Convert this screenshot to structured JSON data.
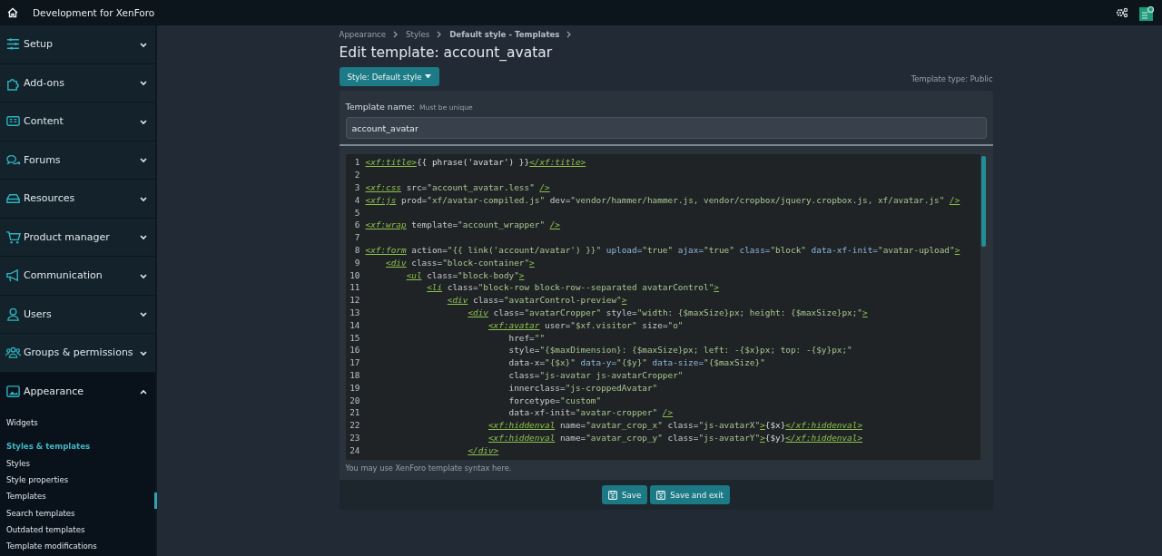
{
  "topbar": {
    "title": "Development for XenForo"
  },
  "sidebar": {
    "items": [
      {
        "label": "Setup",
        "expanded": false
      },
      {
        "label": "Add-ons",
        "expanded": false
      },
      {
        "label": "Content",
        "expanded": false
      },
      {
        "label": "Forums",
        "expanded": false
      },
      {
        "label": "Resources",
        "expanded": false
      },
      {
        "label": "Product manager",
        "expanded": false
      },
      {
        "label": "Communication",
        "expanded": false
      },
      {
        "label": "Users",
        "expanded": false
      },
      {
        "label": "Groups & permissions",
        "expanded": false
      },
      {
        "label": "Appearance",
        "expanded": true,
        "children": [
          {
            "kind": "link",
            "label": "Widgets"
          },
          {
            "kind": "header",
            "label": "Styles & templates"
          },
          {
            "kind": "link",
            "label": "Styles"
          },
          {
            "kind": "link",
            "label": "Style properties"
          },
          {
            "kind": "link",
            "label": "Templates"
          },
          {
            "kind": "link",
            "label": "Search templates"
          },
          {
            "kind": "link",
            "label": "Outdated templates"
          },
          {
            "kind": "link",
            "label": "Template modifications"
          }
        ]
      }
    ]
  },
  "breadcrumbs": [
    {
      "label": "Appearance",
      "bold": false
    },
    {
      "label": "Styles",
      "bold": false
    },
    {
      "label": "Default style - Templates",
      "bold": true
    }
  ],
  "page_title": "Edit template: account_avatar",
  "style_button": "Style: Default style",
  "template_type": "Template type: Public",
  "form": {
    "name_label": "Template name:",
    "name_hint": "Must be unique",
    "name_value": "account_avatar",
    "editor_hint": "You may use XenForo template syntax here."
  },
  "code_lines": [
    {
      "number": "1",
      "tokens": [
        {
          "kind": "tag",
          "text": "<xf:title>"
        },
        {
          "kind": "text",
          "text": "{{ phrase('avatar') }}"
        },
        {
          "kind": "tag",
          "text": "</xf:title>"
        }
      ]
    },
    {
      "number": "2"
    },
    {
      "number": "3",
      "tokens": [
        {
          "kind": "tag",
          "text": "<xf:css"
        },
        {
          "kind": "attr",
          "text": " src="
        },
        {
          "kind": "str",
          "text": "\"account_avatar.less\""
        },
        {
          "kind": "endtag",
          "text": "/>"
        }
      ]
    },
    {
      "number": "4",
      "tokens": [
        {
          "kind": "tag",
          "text": "<xf:js"
        },
        {
          "kind": "attr",
          "text": " prod="
        },
        {
          "kind": "str",
          "text": "\"xf/avatar-compiled.js\""
        },
        {
          "kind": "attr",
          "text": " dev="
        },
        {
          "kind": "str",
          "text": "\"vendor/hammer/hammer.js, vendor/cropbox/jquery.cropbox.js, xf/avatar.js\""
        },
        {
          "kind": "endtag",
          "text": "/>"
        }
      ]
    },
    {
      "number": "5"
    },
    {
      "number": "6",
      "tokens": [
        {
          "kind": "tag",
          "text": "<xf:wrap"
        },
        {
          "kind": "attr",
          "text": " template="
        },
        {
          "kind": "str",
          "text": "\"account_wrapper\""
        },
        {
          "kind": "endtag",
          "text": "/>"
        }
      ]
    },
    {
      "number": "7"
    },
    {
      "number": "8",
      "tokens": [
        {
          "kind": "tag",
          "text": "<xf:form"
        },
        {
          "kind": "attr",
          "text": " action="
        },
        {
          "kind": "str",
          "text": "\"{{ link('account/avatar') }}\""
        },
        {
          "kind": "key",
          "text": " upload="
        },
        {
          "kind": "str",
          "text": "\"true\""
        },
        {
          "kind": "key",
          "text": " ajax="
        },
        {
          "kind": "str",
          "text": "\"true\""
        },
        {
          "kind": "key",
          "text": " class="
        },
        {
          "kind": "str",
          "text": "\"block\""
        },
        {
          "kind": "key",
          "text": " data-xf-init="
        },
        {
          "kind": "str",
          "text": "\"avatar-upload\""
        },
        {
          "kind": "tag",
          "text": ">"
        }
      ],
      "children": [
        {
          "number": "9",
          "tokens": [
            {
              "kind": "tag",
              "text": "<div"
            },
            {
              "kind": "attr",
              "text": " class="
            },
            {
              "kind": "str",
              "text": "\"block-container\""
            },
            {
              "kind": "tag",
              "text": ">"
            }
          ],
          "children": [
            {
              "number": "10",
              "tokens": [
                {
                  "kind": "tag",
                  "text": "<ul"
                },
                {
                  "kind": "attr",
                  "text": " class="
                },
                {
                  "kind": "str",
                  "text": "\"block-body\""
                },
                {
                  "kind": "tag",
                  "text": ">"
                }
              ],
              "children": [
                {
                  "number": "11",
                  "tokens": [
                    {
                      "kind": "tag",
                      "text": "<li"
                    },
                    {
                      "kind": "attr",
                      "text": " class="
                    },
                    {
                      "kind": "str",
                      "text": "\"block-row block-row--separated avatarControl\""
                    },
                    {
                      "kind": "tag",
                      "text": ">"
                    }
                  ],
                  "children": [
                    {
                      "number": "12",
                      "tokens": [
                        {
                          "kind": "tag",
                          "text": "<div"
                        },
                        {
                          "kind": "attr",
                          "text": " class="
                        },
                        {
                          "kind": "str",
                          "text": "\"avatarControl-preview\""
                        },
                        {
                          "kind": "tag",
                          "text": ">"
                        }
                      ],
                      "children": [
                        {
                          "number": "13",
                          "tokens": [
                            {
                              "kind": "tag",
                              "text": "<div"
                            },
                            {
                              "kind": "attr",
                              "text": " class="
                            },
                            {
                              "kind": "str",
                              "text": "\"avatarCropper\""
                            },
                            {
                              "kind": "attr",
                              "text": " style="
                            },
                            {
                              "kind": "str",
                              "text": "\"width: {$maxSize}px; height: {$maxSize}px;\""
                            },
                            {
                              "kind": "tag",
                              "text": ">"
                            }
                          ],
                          "children": [
                            {
                              "number": "14",
                              "tokens": [
                                {
                                  "kind": "tag",
                                  "text": "<xf:avatar"
                                },
                                {
                                  "kind": "attr",
                                  "text": " user="
                                },
                                {
                                  "kind": "str",
                                  "text": "\"$xf.visitor\""
                                },
                                {
                                  "kind": "attr",
                                  "text": " size="
                                },
                                {
                                  "kind": "str",
                                  "text": "\"o\""
                                }
                              ],
                              "children": [
                                {
                                  "number": "15",
                                  "tokens": [
                                    {
                                      "kind": "attr",
                                      "text": "href="
                                    },
                                    {
                                      "kind": "str",
                                      "text": "\"\""
                                    }
                                  ]
                                },
                                {
                                  "number": "16",
                                  "tokens": [
                                    {
                                      "kind": "attr",
                                      "text": "style="
                                    },
                                    {
                                      "kind": "str",
                                      "text": "\"{$maxDimension}: {$maxSize}px; left: -{$x}px; top: -{$y}px;\""
                                    }
                                  ]
                                },
                                {
                                  "number": "17",
                                  "tokens": [
                                    {
                                      "kind": "attr",
                                      "text": "data-x="
                                    },
                                    {
                                      "kind": "str",
                                      "text": "\"{$x}\""
                                    },
                                    {
                                      "kind": "key",
                                      "text": " data-y="
                                    },
                                    {
                                      "kind": "str",
                                      "text": "\"{$y}\""
                                    },
                                    {
                                      "kind": "key",
                                      "text": " data-size="
                                    },
                                    {
                                      "kind": "str",
                                      "text": "\"{$maxSize}\""
                                    }
                                  ]
                                },
                                {
                                  "number": "18",
                                  "tokens": [
                                    {
                                      "kind": "attr",
                                      "text": "class="
                                    },
                                    {
                                      "kind": "str",
                                      "text": "\"js-avatar js-avatarCropper\""
                                    }
                                  ]
                                },
                                {
                                  "number": "19",
                                  "tokens": [
                                    {
                                      "kind": "attr",
                                      "text": "innerclass="
                                    },
                                    {
                                      "kind": "str",
                                      "text": "\"js-croppedAvatar\""
                                    }
                                  ]
                                },
                                {
                                  "number": "20",
                                  "tokens": [
                                    {
                                      "kind": "attr",
                                      "text": "forcetype="
                                    },
                                    {
                                      "kind": "str",
                                      "text": "\"custom\""
                                    }
                                  ]
                                },
                                {
                                  "number": "21",
                                  "tokens": [
                                    {
                                      "kind": "attr",
                                      "text": "data-xf-init="
                                    },
                                    {
                                      "kind": "str",
                                      "text": "\"avatar-cropper\""
                                    },
                                    {
                                      "kind": "endtag",
                                      "text": "/>"
                                    }
                                  ]
                                }
                              ]
                            },
                            {
                              "number": "22",
                              "tokens": [
                                {
                                  "kind": "tag",
                                  "text": "<xf:hiddenval"
                                },
                                {
                                  "kind": "attr",
                                  "text": " name="
                                },
                                {
                                  "kind": "str",
                                  "text": "\"avatar_crop_x\""
                                },
                                {
                                  "kind": "attr",
                                  "text": " class="
                                },
                                {
                                  "kind": "str",
                                  "text": "\"js-avatarX\""
                                },
                                {
                                  "kind": "tag",
                                  "text": ">"
                                },
                                {
                                  "kind": "text",
                                  "text": "{$x}"
                                },
                                {
                                  "kind": "tag",
                                  "text": "</xf:hiddenval>"
                                }
                              ]
                            },
                            {
                              "number": "23",
                              "tokens": [
                                {
                                  "kind": "tag",
                                  "text": "<xf:hiddenval"
                                },
                                {
                                  "kind": "attr",
                                  "text": " name="
                                },
                                {
                                  "kind": "str",
                                  "text": "\"avatar_crop_y\""
                                },
                                {
                                  "kind": "attr",
                                  "text": " class="
                                },
                                {
                                  "kind": "str",
                                  "text": "\"js-avatarY\""
                                },
                                {
                                  "kind": "tag",
                                  "text": ">"
                                },
                                {
                                  "kind": "text",
                                  "text": "{$y}"
                                },
                                {
                                  "kind": "tag",
                                  "text": "</xf:hiddenval>"
                                }
                              ]
                            }
                          ]
                        },
                        {
                          "number": "24",
                          "tokens": [
                            {
                              "kind": "tag",
                              "text": "</div>"
                            }
                          ]
                        }
                      ]
                    }
                  ]
                }
              ]
            }
          ]
        }
      ]
    }
  ],
  "buttons": [
    {
      "label": "Save"
    },
    {
      "label": "Save and exit"
    }
  ]
}
